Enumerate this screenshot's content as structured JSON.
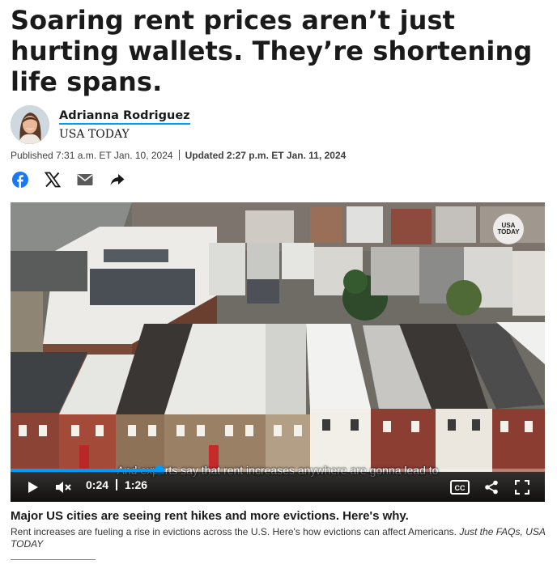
{
  "article": {
    "headline": "Soaring rent prices aren’t just hurting wallets. They’re shortening life spans.",
    "author": {
      "name": "Adrianna Rodriguez",
      "organization": "USA TODAY",
      "avatar_icon": "author-photo"
    },
    "dates": {
      "published": "Published 7:31 a.m. ET Jan. 10, 2024",
      "updated": "Updated 2:27 p.m. ET Jan. 11, 2024"
    },
    "share_icons": [
      "facebook-icon",
      "x-icon",
      "email-icon",
      "share-arrow-icon"
    ]
  },
  "video": {
    "logo_line1": "USA",
    "logo_line2": "TODAY",
    "caption": "And experts say that rent increases anywhere are gonna lead to",
    "current_time": "0:24",
    "duration": "1:26",
    "progress": 0.279,
    "cc_label": "CC",
    "title": "Major US cities are seeing rent hikes and more evictions. Here's why.",
    "description": "Rent increases are fueling a rise in evictions across the U.S. Here's how evictions can affect Americans.",
    "credit": "Just the FAQs, USA TODAY"
  },
  "colors": {
    "accent": "#009bff",
    "facebook": "#1877f2",
    "text": "#1a1a1a"
  }
}
